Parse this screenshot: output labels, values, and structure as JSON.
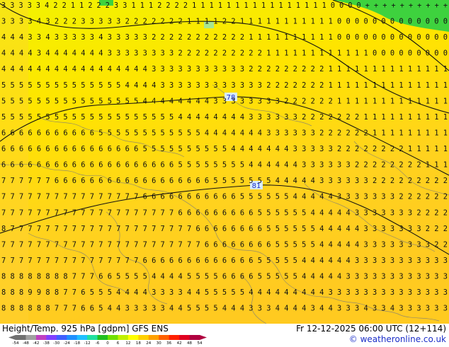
{
  "footer": {
    "title": "Height/Temp. 925 hPa [gdpm] GFS ENS",
    "datetime": "Fr 12-12-2025 06:00 UTC (12+114)",
    "credit": "© weatheronline.co.uk"
  },
  "contour_labels": [
    "78",
    "81"
  ],
  "colorbar": {
    "ticks": [
      "-54",
      "-48",
      "-42",
      "-38",
      "-30",
      "-24",
      "-18",
      "-12",
      "-6",
      "0",
      "6",
      "12",
      "18",
      "24",
      "30",
      "36",
      "42",
      "48",
      "54"
    ],
    "colors": [
      "#707070",
      "#a0a0a0",
      "#c040c0",
      "#8040ff",
      "#4060ff",
      "#2090ff",
      "#20c0ff",
      "#20e0a0",
      "#20c020",
      "#70e000",
      "#c0f000",
      "#ffff00",
      "#ffd000",
      "#ffa000",
      "#ff6000",
      "#ff2000",
      "#e00020",
      "#b00040"
    ]
  },
  "temperature_grid": [
    "3 3 3 3 3 4 2 2 1 1 2 2 2 3 3 1 1 1 2 2 2 2 1 1 1 1 1 1 1 1 1 1 1 1 1 1 1 1 0 0 0 0 + + + + + + + + + +",
    "3 3 3 3 4 3 2 2 2 3 3 3 3 3 2 2 2 2 2 2 2 1 1 1 1 2 2 1 1 1 1 1 1 1 1 1 1 1 0 0 0 0 0 0 0 0 0 0 0 0 0",
    "4 4 4 3 3 4 3 3 3 3 3 4 3 3 3 3 3 2 2 2 2 2 2 2 2 2 2 2 1 1 1 1 1 1 1 1 1 1 0 0 0 0 0 0 0 0 0 0 0 0 0",
    "4 4 4 4 3 4 4 4 4 4 4 4 3 3 3 3 3 3 3 3 2 2 2 2 2 2 2 2 2 2 1 1 1 1 1 1 1 1 1 1 1 1 0 0 0 0 0 0 0 0 0",
    "4 4 4 4 4 4 4 4 4 4 4 4 4 4 4 4 4 3 3 3 3 3 3 3 3 3 3 3 2 2 2 2 2 2 2 2 2 1 1 1 1 1 1 1 1 1 1 1 1 1 1",
    "5 5 5 5 5 5 5 5 5 5 5 5 5 5 4 4 4 4 3 3 3 3 3 3 3 3 3 3 3 3 2 2 2 2 2 2 2 1 1 1 1 1 1 1 1 1 1 1 1 1 1",
    "5 5 5 5 5 5 5 5 5 5 5 5 5 5 5 5 4 4 4 4 4 4 4 4 3 3 3 3 3 3 3 3 2 2 2 2 2 2 1 1 1 1 1 1 1 1 1 1 1 1 1",
    "5 5 5 5 5 5 5 5 5 5 5 5 5 5 5 5 5 5 5 5 4 4 4 4 4 4 4 4 3 3 3 3 3 3 2 2 2 2 2 2 2 1 1 1 1 1 1 1 1 1 1",
    "6 6 6 6 6 6 6 6 6 6 6 5 5 5 5 5 5 5 5 5 5 5 5 4 4 4 4 4 4 4 3 3 3 3 3 3 2 2 2 2 2 2 1 1 1 1 1 1 1 1 1",
    "6 6 6 6 6 6 6 6 6 6 6 6 6 6 6 6 5 5 5 5 5 5 5 5 5 5 4 4 4 4 4 4 4 3 3 3 3 3 2 2 2 2 2 2 2 2 1 1 1 1 1",
    "6 6 6 6 6 6 6 6 6 6 6 6 6 6 6 6 6 6 6 6 5 5 5 5 5 5 5 5 4 4 4 4 4 4 3 3 3 3 3 3 2 2 2 2 2 2 2 2 1 1 1",
    "7 7 7 7 7 7 6 6 6 6 6 6 6 6 6 6 6 6 6 6 6 6 6 6 5 5 5 5 5 5 5 4 4 4 4 4 3 3 3 3 3 3 2 2 2 2 2 2 2 2 2",
    "7 7 7 7 7 7 7 7 7 7 7 7 7 7 7 7 6 6 6 6 6 6 6 6 6 6 6 5 5 5 5 5 5 4 4 4 4 4 3 3 3 3 3 3 3 2 2 2 2 2 2",
    "7 7 7 7 7 7 7 7 7 7 7 7 7 7 7 7 7 7 7 7 6 6 6 6 6 6 6 6 6 5 5 5 5 5 5 4 4 4 4 4 3 3 3 3 3 3 3 2 2 2 2",
    "8 7 7 7 7 7 7 7 7 7 7 7 7 7 7 7 7 7 7 7 7 7 6 6 6 6 6 6 6 6 5 5 5 5 5 5 4 4 4 4 4 3 3 3 3 3 3 3 2 2 2",
    "7 7 7 7 7 7 7 7 7 7 7 7 7 7 7 7 7 7 7 7 7 7 7 6 6 6 6 6 6 6 6 5 5 5 5 5 4 4 4 4 4 3 3 3 3 3 3 3 3 2 2",
    "7 7 7 7 7 7 7 7 7 7 7 7 7 7 7 7 6 6 6 6 6 6 6 6 6 6 6 6 6 5 5 5 5 5 4 4 4 4 4 4 3 3 3 3 3 3 3 3 3 3 3",
    "8 8 8 8 8 8 8 8 7 7 7 6 6 5 5 5 5 4 4 4 4 5 5 5 5 6 6 6 6 5 5 5 5 5 4 4 4 4 4 3 3 3 3 3 3 3 3 3 3 3 3",
    "8 8 8 9 9 8 8 7 7 6 5 5 5 4 4 4 4 3 3 3 3 4 4 5 5 5 5 5 4 4 4 4 4 4 4 4 4 3 3 3 3 3 3 3 3 3 3 3 3 3 3",
    "8 8 8 8 8 8 7 7 7 6 6 5 4 4 3 3 3 3 3 4 4 5 5 5 5 4 4 4 3 3 3 4 4 4 4 3 4 4 3 3 3 4 3 3 4 3 3 3 3 3 3"
  ]
}
